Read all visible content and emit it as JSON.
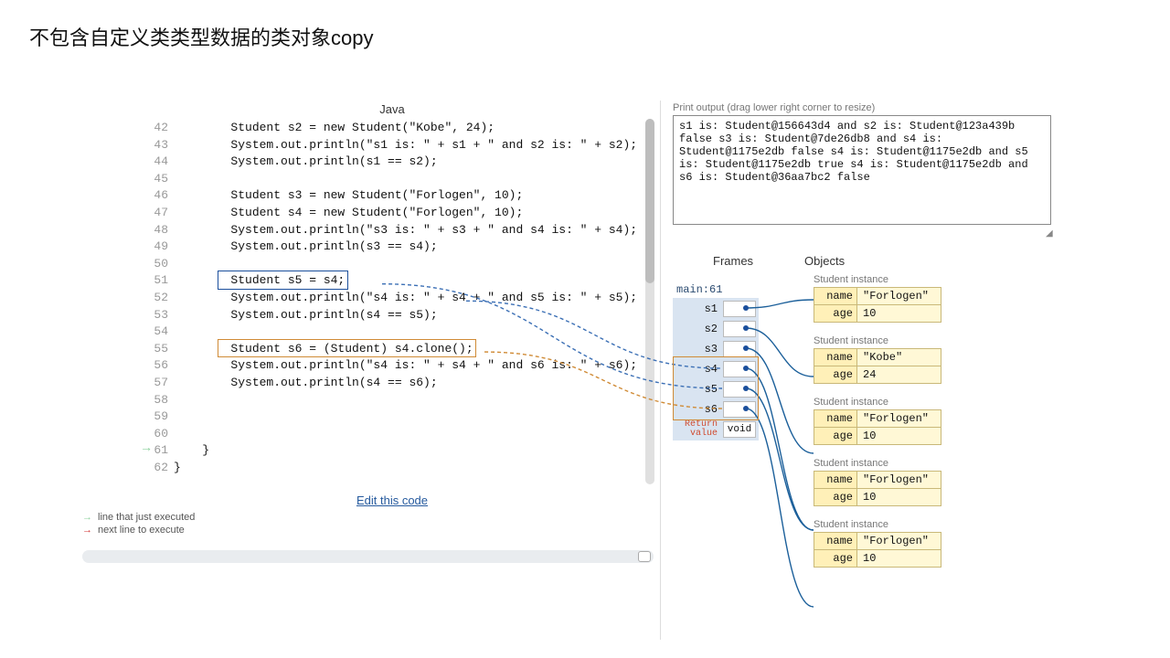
{
  "title": "不包含自定义类类型数据的类对象copy",
  "code": {
    "language": "Java",
    "first_line": 42,
    "lines": [
      "        Student s2 = new Student(\"Kobe\", 24);",
      "        System.out.println(\"s1 is: \" + s1 + \" and s2 is: \" + s2);",
      "        System.out.println(s1 == s2);",
      "",
      "        Student s3 = new Student(\"Forlogen\", 10);",
      "        Student s4 = new Student(\"Forlogen\", 10);",
      "        System.out.println(\"s3 is: \" + s3 + \" and s4 is: \" + s4);",
      "        System.out.println(s3 == s4);",
      "",
      "        Student s5 = s4;",
      "        System.out.println(\"s4 is: \" + s4 + \" and s5 is: \" + s5);",
      "        System.out.println(s4 == s5);",
      "",
      "        Student s6 = (Student) s4.clone();",
      "        System.out.println(\"s4 is: \" + s4 + \" and s6 is: \" + s6);",
      "        System.out.println(s4 == s6);",
      "",
      "",
      "",
      "    }",
      "}"
    ],
    "boxes": [
      {
        "line": 51,
        "text": "Student s5 = s4;",
        "color": "blue"
      },
      {
        "line": 55,
        "text": "Student s6 = (Student) s4.clone();",
        "color": "orange"
      }
    ],
    "execution_marker_line": 61
  },
  "edit_link": "Edit this code",
  "legend": {
    "just_executed": "line that just executed",
    "next_line": "next line to execute"
  },
  "output": {
    "label": "Print output (drag lower right corner to resize)",
    "lines": [
      "s1 is: Student@156643d4 and s2 is: Student@123a439b",
      "false",
      "s3 is: Student@7de26db8 and s4 is: Student@1175e2db",
      "false",
      "s4 is: Student@1175e2db and s5 is: Student@1175e2db",
      "true",
      "s4 is: Student@1175e2db and s6 is: Student@36aa7bc2",
      "false"
    ]
  },
  "frames_header": "Frames",
  "objects_header": "Objects",
  "frame": {
    "title": "main:61",
    "rows": [
      {
        "name": "s1"
      },
      {
        "name": "s2"
      },
      {
        "name": "s3"
      },
      {
        "name": "s4"
      },
      {
        "name": "s5"
      },
      {
        "name": "s6"
      }
    ],
    "return_label": "Return\nvalue",
    "return_value": "void"
  },
  "objects": [
    {
      "label": "Student instance",
      "fields": [
        [
          "name",
          "\"Forlogen\""
        ],
        [
          "age",
          "10"
        ]
      ]
    },
    {
      "label": "Student instance",
      "fields": [
        [
          "name",
          "\"Kobe\""
        ],
        [
          "age",
          "24"
        ]
      ]
    },
    {
      "label": "Student instance",
      "fields": [
        [
          "name",
          "\"Forlogen\""
        ],
        [
          "age",
          "10"
        ]
      ]
    },
    {
      "label": "Student instance",
      "fields": [
        [
          "name",
          "\"Forlogen\""
        ],
        [
          "age",
          "10"
        ]
      ]
    },
    {
      "label": "Student instance",
      "fields": [
        [
          "name",
          "\"Forlogen\""
        ],
        [
          "age",
          "10"
        ]
      ]
    }
  ],
  "pointers": [
    {
      "from": "s1",
      "to": 0
    },
    {
      "from": "s2",
      "to": 1
    },
    {
      "from": "s3",
      "to": 2
    },
    {
      "from": "s4",
      "to": 3
    },
    {
      "from": "s5",
      "to": 3
    },
    {
      "from": "s6",
      "to": 4
    }
  ]
}
